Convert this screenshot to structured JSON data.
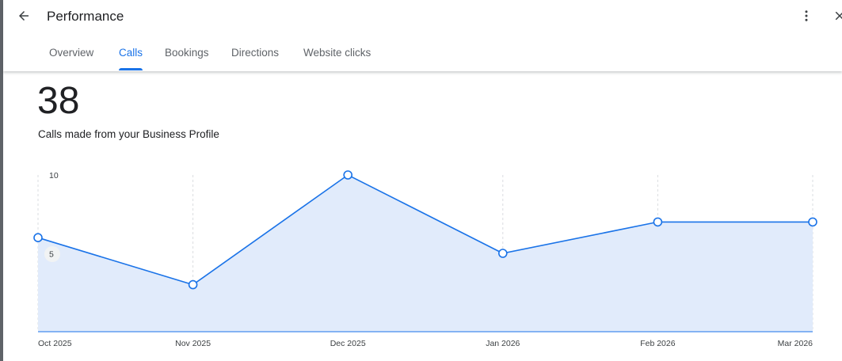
{
  "header": {
    "title": "Performance",
    "back_icon": "arrow-back-icon",
    "more_icon": "more-vert-icon",
    "close_icon": "close-icon"
  },
  "tabs": [
    {
      "label": "Overview",
      "active": false
    },
    {
      "label": "Calls",
      "active": true
    },
    {
      "label": "Bookings",
      "active": false
    },
    {
      "label": "Directions",
      "active": false
    },
    {
      "label": "Website clicks",
      "active": false
    }
  ],
  "metric": {
    "value": "38",
    "label": "Calls made from your Business Profile"
  },
  "colors": {
    "accent": "#1a73e8",
    "area_fill": "#e1ebfb",
    "grid": "#dadce0"
  },
  "chart_data": {
    "type": "area",
    "categories": [
      "Oct 2025",
      "Nov 2025",
      "Dec 2025",
      "Jan 2026",
      "Feb 2026",
      "Mar 2026"
    ],
    "values": [
      6,
      3,
      10,
      5,
      7,
      7
    ],
    "y_ticks": [
      5,
      10
    ],
    "ylim": [
      0,
      10
    ],
    "grid": "vertical dashed"
  }
}
